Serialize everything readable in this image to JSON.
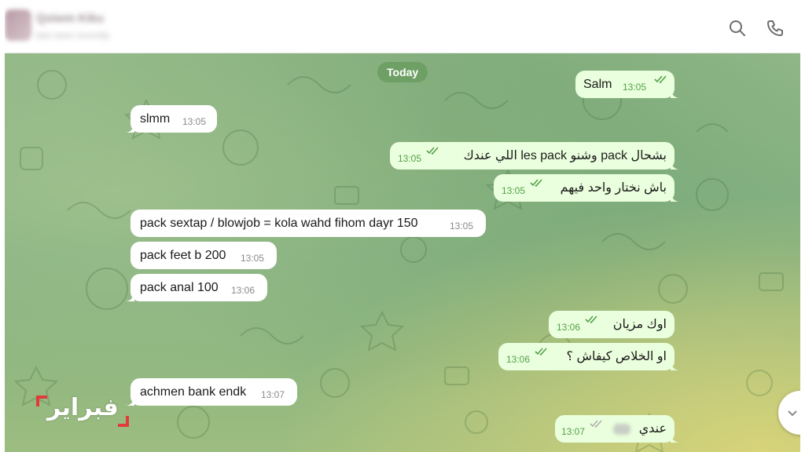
{
  "header": {
    "contact_name": "Qsiwm Kiku",
    "contact_status": "last seen recently",
    "icons": [
      "search-icon",
      "phone-icon"
    ]
  },
  "chat": {
    "date_label": "Today",
    "messages": [
      {
        "dir": "out",
        "text": "Salm",
        "time": "13:05",
        "status": "read"
      },
      {
        "dir": "in",
        "text": "slmm",
        "time": "13:05"
      },
      {
        "dir": "out",
        "text": "بشحال pack وشنو les pack اللي عندك",
        "time": "13:05",
        "status": "read"
      },
      {
        "dir": "out",
        "text": "باش نختار واحد فيهم",
        "time": "13:05",
        "status": "read"
      },
      {
        "dir": "in",
        "text": "pack sextap / blowjob = kola wahd fihom dayr 150",
        "time": "13:05"
      },
      {
        "dir": "in",
        "text": "pack feet b 200",
        "time": "13:05"
      },
      {
        "dir": "in",
        "text": "pack anal 100",
        "time": "13:06"
      },
      {
        "dir": "out",
        "text": "اوك مزيان",
        "time": "13:06",
        "status": "read"
      },
      {
        "dir": "out",
        "text": "او الخلاص كيفاش ؟",
        "time": "13:06",
        "status": "read"
      },
      {
        "dir": "in",
        "text": "achmen bank endk",
        "time": "13:07"
      },
      {
        "dir": "out",
        "text": "عندي",
        "time": "13:07",
        "status": "read"
      }
    ]
  },
  "watermark": {
    "text": "فبراير",
    "color": "#e23b3b"
  },
  "colors": {
    "incoming": "#ffffff",
    "outgoing": "#eaffdd",
    "accent": "#55a04c",
    "date_pill": "#6e9f64"
  }
}
